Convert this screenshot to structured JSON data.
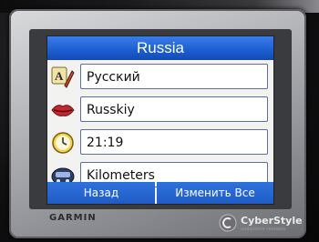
{
  "screen": {
    "title": "Russia",
    "rows": [
      {
        "icon": "language-icon",
        "value": "Русский"
      },
      {
        "icon": "voice-lips-icon",
        "value": "Russkiy"
      },
      {
        "icon": "clock-icon",
        "value": "21:19"
      },
      {
        "icon": "car-units-icon",
        "value": "Kilometers"
      }
    ],
    "buttons": {
      "back_label": "Назад",
      "edit_all_label": "Изменить Все"
    }
  },
  "device": {
    "brand": "GARMIN"
  },
  "watermark": {
    "title": "CyberStyle",
    "subtitle": "цифровая техника"
  },
  "colors": {
    "title_blue": "#1b5ed0",
    "button_blue": "#1f5cc6",
    "field_border": "#5d6fa0"
  }
}
